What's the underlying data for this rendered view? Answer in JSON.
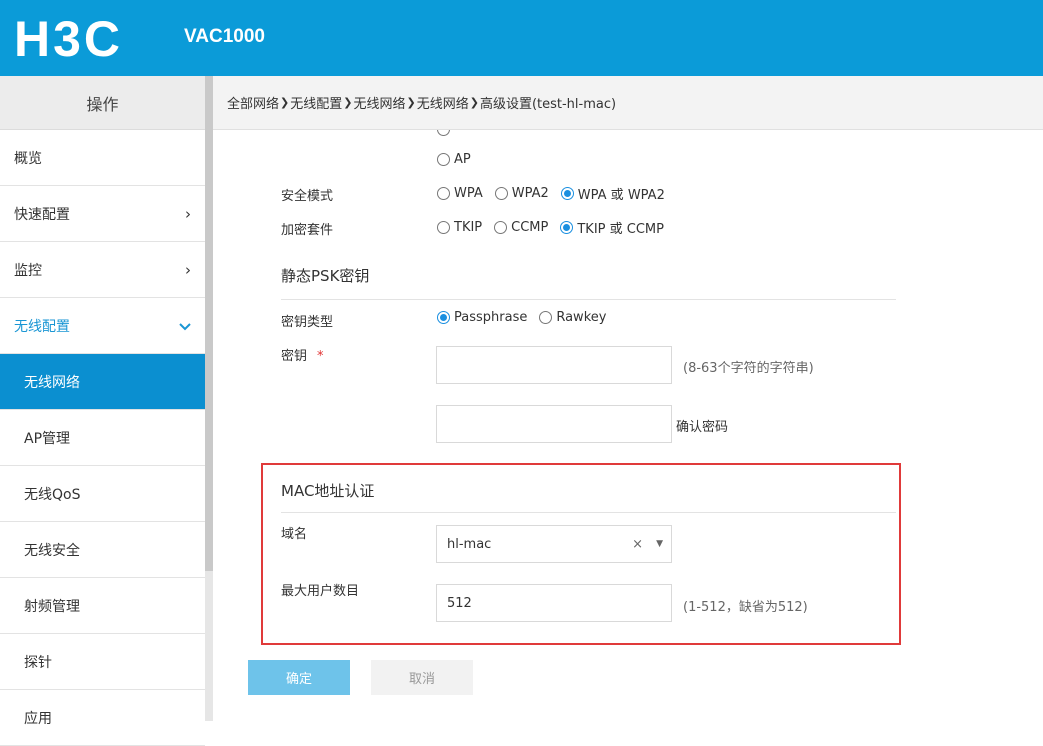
{
  "header": {
    "logo_text": "H3C",
    "product": "VAC1000"
  },
  "sidebar": {
    "title": "操作",
    "items": [
      {
        "label": "概览"
      },
      {
        "label": "快速配置",
        "chevron": "›"
      },
      {
        "label": "监控",
        "chevron": "›"
      },
      {
        "label": "无线配置",
        "chevron": "⌄"
      },
      {
        "label": "无线网络"
      },
      {
        "label": "AP管理"
      },
      {
        "label": "无线QoS"
      },
      {
        "label": "无线安全"
      },
      {
        "label": "射频管理"
      },
      {
        "label": "探针"
      },
      {
        "label": "应用"
      }
    ]
  },
  "breadcrumb": {
    "items": [
      "全部网络",
      "无线配置",
      "无线网络",
      "无线网络",
      "高级设置(test-hl-mac)"
    ],
    "separator": "❯"
  },
  "form": {
    "ap_option": "AP",
    "security_mode": {
      "label": "安全模式",
      "options": [
        "WPA",
        "WPA2",
        "WPA 或 WPA2"
      ],
      "selected": "WPA 或 WPA2"
    },
    "cipher_suite": {
      "label": "加密套件",
      "options": [
        "TKIP",
        "CCMP",
        "TKIP 或 CCMP"
      ],
      "selected": "TKIP 或 CCMP"
    },
    "psk_section_title": "静态PSK密钥",
    "key_type": {
      "label": "密钥类型",
      "options": [
        "Passphrase",
        "Rawkey"
      ],
      "selected": "Passphrase"
    },
    "key": {
      "label": "密钥",
      "required_mark": "*",
      "value": "",
      "hint": "(8-63个字符的字符串)"
    },
    "confirm_key": {
      "value": "",
      "hint": "确认密码"
    },
    "mac_section_title": "MAC地址认证",
    "domain": {
      "label": "域名",
      "value": "hl-mac",
      "clear_icon": "×",
      "caret_icon": "▼"
    },
    "max_users": {
      "label": "最大用户数目",
      "value": "512",
      "hint": "(1-512，缺省为512)"
    },
    "ok_label": "确定",
    "cancel_label": "取消"
  },
  "colors": {
    "header_bg": "#0b9bd8",
    "sidebar_selected_bg": "#0b8fd0",
    "accent": "#1a96d4",
    "highlight_box": "#e03a3a",
    "ok_button_bg": "#6ec3ea"
  }
}
